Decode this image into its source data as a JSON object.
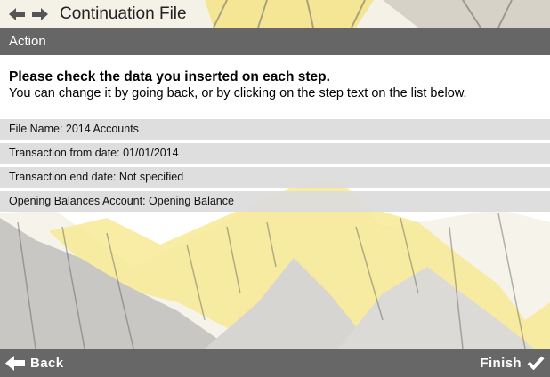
{
  "window": {
    "title": "Continuation File"
  },
  "section": {
    "title": "Action"
  },
  "intro": {
    "heading": "Please check the data you inserted on each step.",
    "subtext": "You can change it by going back, or by clicking on the step text on the list below."
  },
  "steps": [
    {
      "label": "File Name: 2014 Accounts"
    },
    {
      "label": "Transaction from date: 01/01/2014"
    },
    {
      "label": "Transaction end date: Not specified"
    },
    {
      "label": "Opening Balances Account: Opening Balance"
    }
  ],
  "footer": {
    "back_label": "Back",
    "finish_label": "Finish"
  },
  "icons": {
    "nav_back": "arrow-left-icon",
    "nav_forward": "arrow-right-icon",
    "back": "arrow-left-icon",
    "finish": "checkmark-icon"
  },
  "colors": {
    "section_bar": "#666666",
    "bottom_bar": "#676767",
    "list_row": "#dcdcdc",
    "accent_yellow": "#f5e06a"
  }
}
